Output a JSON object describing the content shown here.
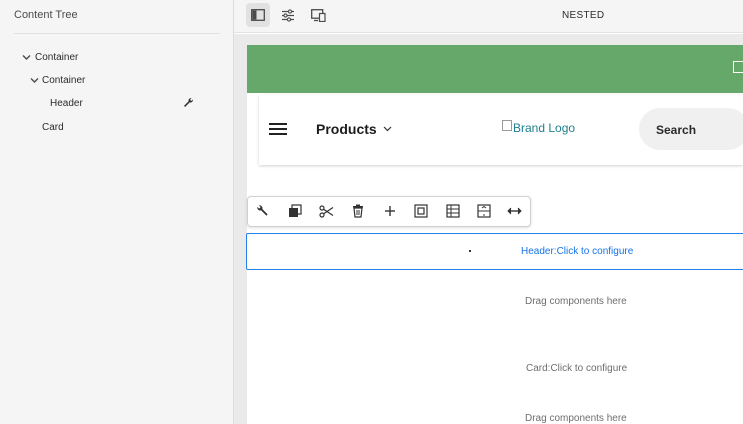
{
  "content_tree": {
    "title": "Content Tree",
    "items": [
      {
        "label": "Container",
        "expanded": true,
        "level": 0
      },
      {
        "label": "Container",
        "expanded": true,
        "level": 1
      },
      {
        "label": "Header",
        "level": 2
      },
      {
        "label": "Card",
        "level": 1
      }
    ]
  },
  "topbar": {
    "title": "NESTED",
    "buttons": [
      "side-panel-icon",
      "properties-icon",
      "emulator-icon"
    ]
  },
  "page": {
    "header_bar_color": "#66a86a",
    "nav": {
      "menu_icon": "hamburger-icon",
      "products_label": "Products",
      "brand_logo_alt": "Brand Logo",
      "search_label": "Search"
    }
  },
  "edit_toolbar": {
    "icons": [
      "wrench-icon",
      "copy-icon",
      "cut-icon",
      "delete-icon",
      "insert-icon",
      "group-icon",
      "layout-icon",
      "parent-icon",
      "resize-icon"
    ]
  },
  "editor": {
    "header_placeholder": "Header:Click to configure",
    "drag_here_1": "Drag components here",
    "card_placeholder": "Card:Click to configure",
    "drag_here_2": "Drag components here"
  },
  "colors": {
    "selection": "#2680eb",
    "link": "#1473e6"
  }
}
